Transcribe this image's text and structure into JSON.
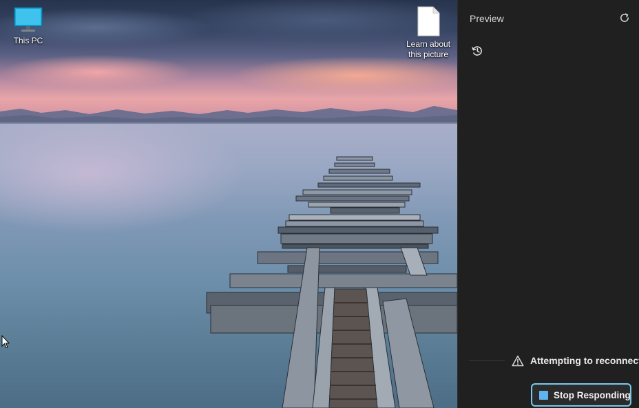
{
  "desktop": {
    "icons": [
      {
        "label": "This PC"
      },
      {
        "label": "Learn about this picture"
      }
    ]
  },
  "panel": {
    "title": "Preview",
    "status_text": "Attempting to reconnect...",
    "stop_button_label": "Stop Responding",
    "accent_color": "#5fb4f0",
    "button_border_color": "#7fc6e6",
    "icons": {
      "refresh": "refresh-icon",
      "history": "history-icon",
      "warning": "warning-icon",
      "stop": "stop-icon"
    }
  }
}
